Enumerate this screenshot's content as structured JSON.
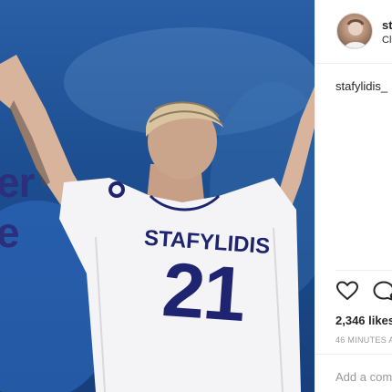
{
  "post": {
    "promo_line_1": "er",
    "promo_line_2": "e",
    "shirt_name": "STAFYLIDIS",
    "shirt_number": "21"
  },
  "header": {
    "username": "st",
    "subtitle": "Cl"
  },
  "caption": {
    "username": "stafylidis_"
  },
  "actions": {
    "like_icon": "heart-icon",
    "comment_icon": "comment-icon"
  },
  "stats": {
    "likes": "2,346 likes",
    "time": "46 MINUTES A"
  },
  "comment": {
    "placeholder": "Add a comment..."
  },
  "colors": {
    "background_blue": "#1d4f92",
    "promo_text": "#2b2f7c",
    "shirt_print": "#1e2470",
    "ui_text": "#262626",
    "muted_text": "#999999"
  }
}
